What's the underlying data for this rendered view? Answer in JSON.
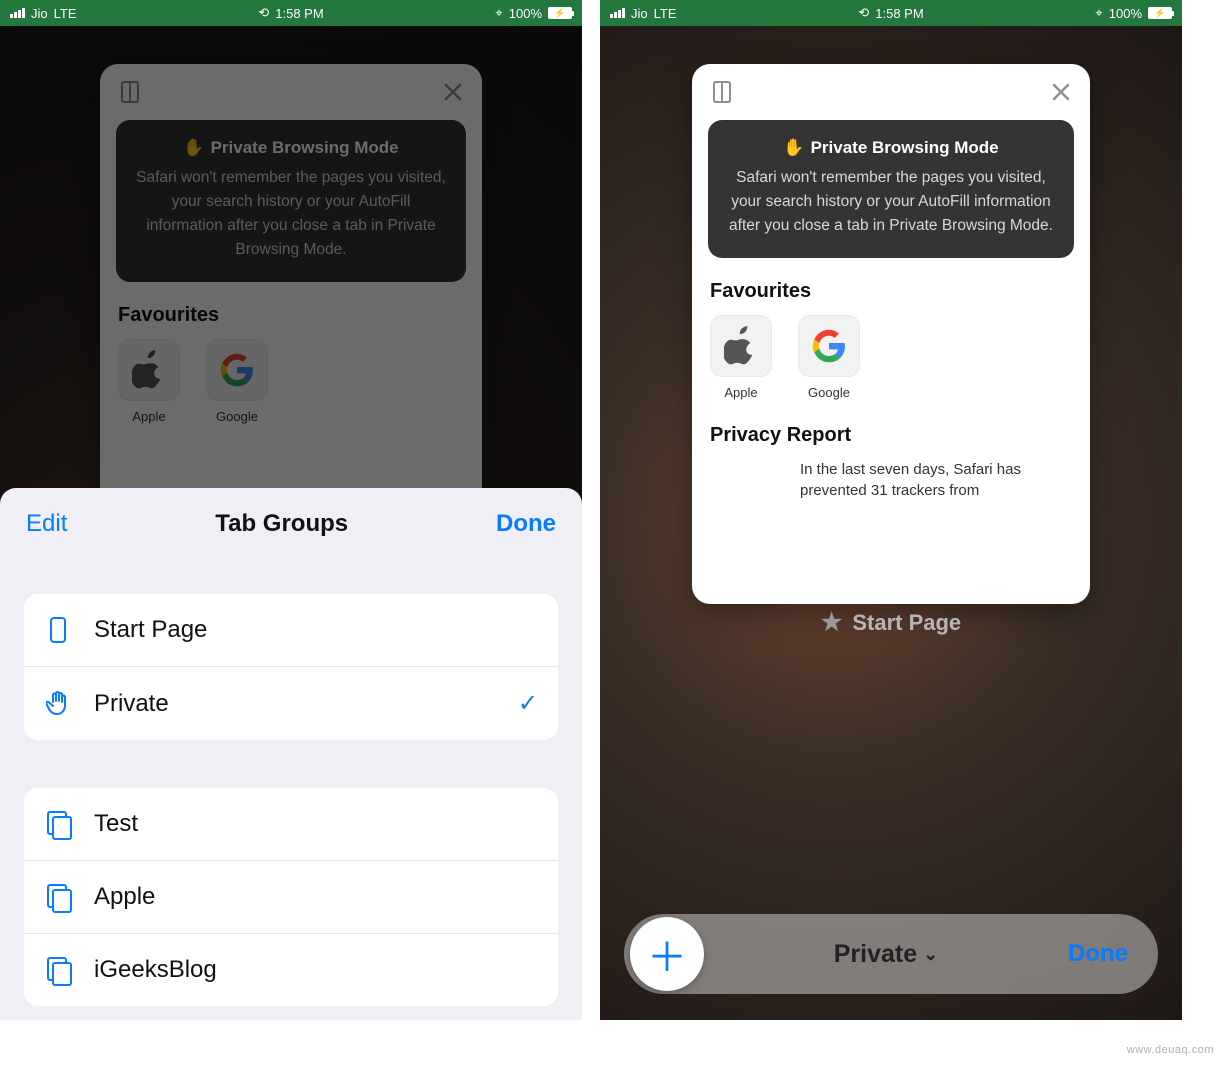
{
  "statusbar": {
    "carrier": "Jio",
    "network": "LTE",
    "time": "1:58 PM",
    "battery_pct": "100%"
  },
  "private_mode": {
    "title": "Private Browsing Mode",
    "description": "Safari won't remember the pages you visited, your search history or your AutoFill information after you close a tab in Private Browsing Mode."
  },
  "favourites": {
    "heading": "Favourites",
    "items": [
      {
        "label": "Apple"
      },
      {
        "label": "Google"
      }
    ]
  },
  "privacy_report": {
    "heading": "Privacy Report",
    "body": "In the last seven days, Safari has prevented 31 trackers from"
  },
  "tab_overview": {
    "page_label": "Start Page"
  },
  "sheet": {
    "edit": "Edit",
    "title": "Tab Groups",
    "done": "Done",
    "primary": [
      {
        "label": "Start Page",
        "icon": "phone"
      },
      {
        "label": "Private",
        "icon": "hand",
        "selected": true
      }
    ],
    "groups": [
      {
        "label": "Test"
      },
      {
        "label": "Apple"
      },
      {
        "label": "iGeeksBlog"
      }
    ]
  },
  "bottombar": {
    "group_label": "Private",
    "done": "Done"
  },
  "watermark": "www.deuaq.com"
}
